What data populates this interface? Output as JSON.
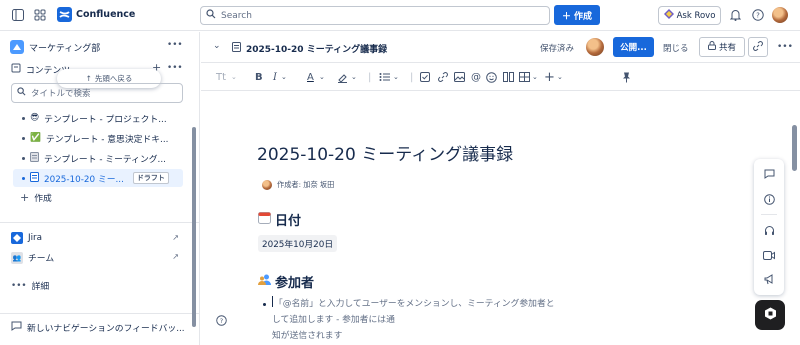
{
  "app": {
    "name": "Confluence"
  },
  "search": {
    "placeholder": "Search"
  },
  "topbar": {
    "create_label": "作成",
    "ask_rovo_label": "Ask Rovo"
  },
  "sidebar": {
    "space_name": "マーケティング部",
    "content_label": "コンテンツ",
    "tooltip": "先頭へ戻る",
    "search_placeholder": "タイトルで検索",
    "tree": [
      {
        "emoji": "😎",
        "label": "テンプレート - プロジェクト..."
      },
      {
        "emoji": "✅",
        "label": "テンプレート - 意思決定ドキ..."
      },
      {
        "emoji": "page",
        "label": "テンプレート - ミーティング..."
      },
      {
        "emoji": "page",
        "label": "2025-10-20 ミー...",
        "badge": "ドラフト",
        "active": true
      }
    ],
    "create_label": "作成",
    "apps": [
      {
        "icon": "jira-icon",
        "label": "Jira"
      },
      {
        "icon": "team-icon",
        "label": "チーム"
      }
    ],
    "more_label": "詳細",
    "feedback_label": "新しいナビゲーションのフィードバッ..."
  },
  "page_header": {
    "breadcrumb_title": "2025-10-20 ミーティング議事録",
    "saved_label": "保存済み",
    "publish_label": "公開...",
    "close_label": "閉じる",
    "share_label": "共有"
  },
  "toolbar": {
    "text_style": "Tt"
  },
  "document": {
    "title": "2025-10-20 ミーティング議事録",
    "byline": "作成者: 加奈 坂田",
    "date_heading": "日付",
    "date_value": "2025年10月20日",
    "attendees_heading": "参加者",
    "attendees_hint_line1": "「@名前」と入力してユーザーをメンションし、ミーティング参加者として追加します - 参加者には通",
    "attendees_hint_line2": "知が送信されます"
  },
  "colors": {
    "brand": "#1868db",
    "text": "#172b4d",
    "subtle": "#626f86"
  }
}
